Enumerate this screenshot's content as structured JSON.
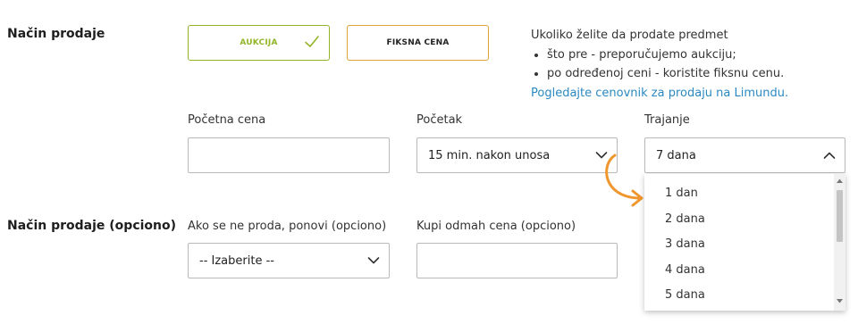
{
  "sections": {
    "main_label": "Način prodaje",
    "optional_label": "Način prodaje (opciono)"
  },
  "sale_type": {
    "auction_label": "AUKCIJA",
    "fixed_label": "FIKSNA CENA",
    "selected": "AUKCIJA"
  },
  "info": {
    "intro": "Ukoliko želite da prodate predmet",
    "bullets": [
      "što pre - preporučujemo aukciju;",
      "po određenoj ceni - koristite fiksnu cenu."
    ],
    "link": "Pogledajte cenovnik za prodaju na Limundu."
  },
  "fields": {
    "start_price_label": "Početna cena",
    "start_price_value": "",
    "start_label": "Početak",
    "start_value": "15 min. nakon unosa",
    "duration_label": "Trajanje",
    "duration_value": "7 dana",
    "repeat_label": "Ako se ne proda, ponovi (opciono)",
    "repeat_value": "-- Izaberite --",
    "buy_now_label": "Kupi odmah cena (opciono)",
    "buy_now_value": ""
  },
  "duration_options": [
    "1 dan",
    "2 dana",
    "3 dana",
    "4 dana",
    "5 dana"
  ],
  "colors": {
    "accent_green": "#93b52a",
    "accent_orange": "#e2a23d",
    "link_blue": "#2a89c0",
    "arrow_orange": "#f0962e"
  },
  "icons": {
    "check": "check-icon",
    "chevron_down": "chevron-down-icon",
    "chevron_up": "chevron-up-icon",
    "annotation_arrow": "curved-arrow-icon"
  }
}
